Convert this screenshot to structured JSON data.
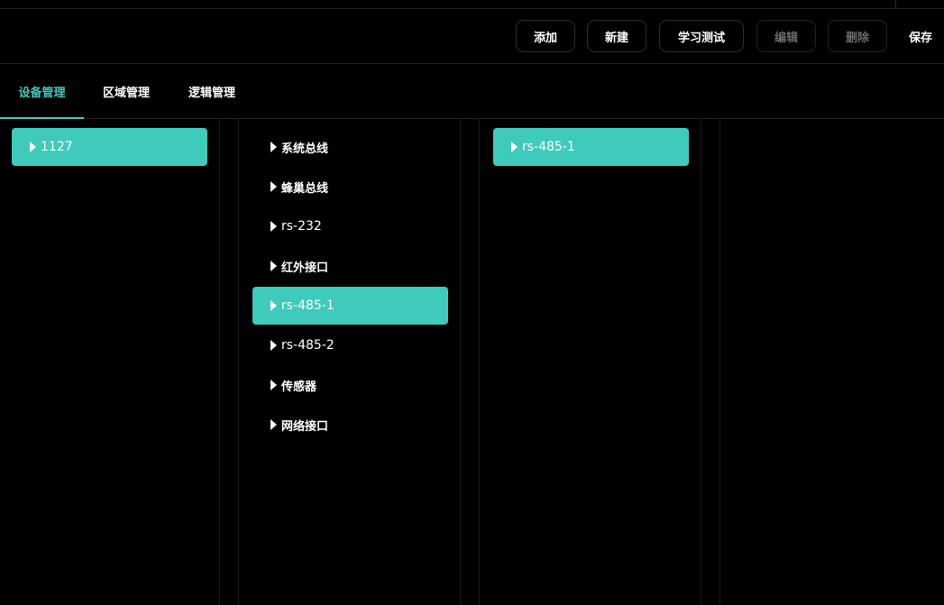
{
  "toolbar": {
    "add_label": "添加",
    "new_label": "新建",
    "learn_test_label": "学习测试",
    "edit_label": "编辑",
    "delete_label": "删除",
    "save_label": "保存"
  },
  "tabs": [
    {
      "label": "设备管理",
      "active": true
    },
    {
      "label": "区域管理",
      "active": false
    },
    {
      "label": "逻辑管理",
      "active": false
    }
  ],
  "column1": {
    "items": [
      {
        "label": "1127",
        "selected": true
      }
    ]
  },
  "column2": {
    "items": [
      {
        "label": "系统总线",
        "selected": false
      },
      {
        "label": "蜂巢总线",
        "selected": false
      },
      {
        "label": "rs-232",
        "selected": false
      },
      {
        "label": "红外接口",
        "selected": false
      },
      {
        "label": "rs-485-1",
        "selected": true
      },
      {
        "label": "rs-485-2",
        "selected": false
      },
      {
        "label": "传感器",
        "selected": false
      },
      {
        "label": "网络接口",
        "selected": false
      }
    ]
  },
  "column3": {
    "items": [
      {
        "label": "rs-485-1",
        "selected": true
      }
    ]
  },
  "colors": {
    "accent": "#3ecbbc",
    "background": "#000000",
    "disabled_text": "#6b6b6b"
  }
}
